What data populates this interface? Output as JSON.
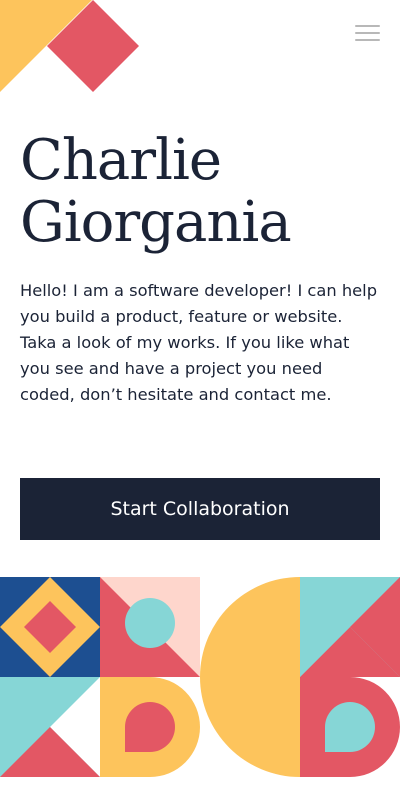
{
  "page": {
    "title": "Charlie Giorgania"
  },
  "header": {
    "logo_icon": "geometric-logo-icon",
    "menu_icon": "hamburger-menu-icon"
  },
  "hero": {
    "title_line_1": "Charlie",
    "title_line_2": "Giorgania",
    "intro": "Hello! I am a software developer! I can help you build a product, feature or website. Taka a look of my works. If you like what you see and have a project you need coded, don’t hesitate and contact me.",
    "cta_label": "Start Collaboration"
  },
  "colors": {
    "navy": "#1b2336",
    "red": "#e35764",
    "yellow": "#fdc45c",
    "teal": "#86d6d6",
    "blue": "#1d4f91",
    "peach": "#fed6cc",
    "menu_gray": "#b8b8b8",
    "background": "#ffffff"
  },
  "decor": {
    "pattern": "geometric-shapes-pattern"
  }
}
